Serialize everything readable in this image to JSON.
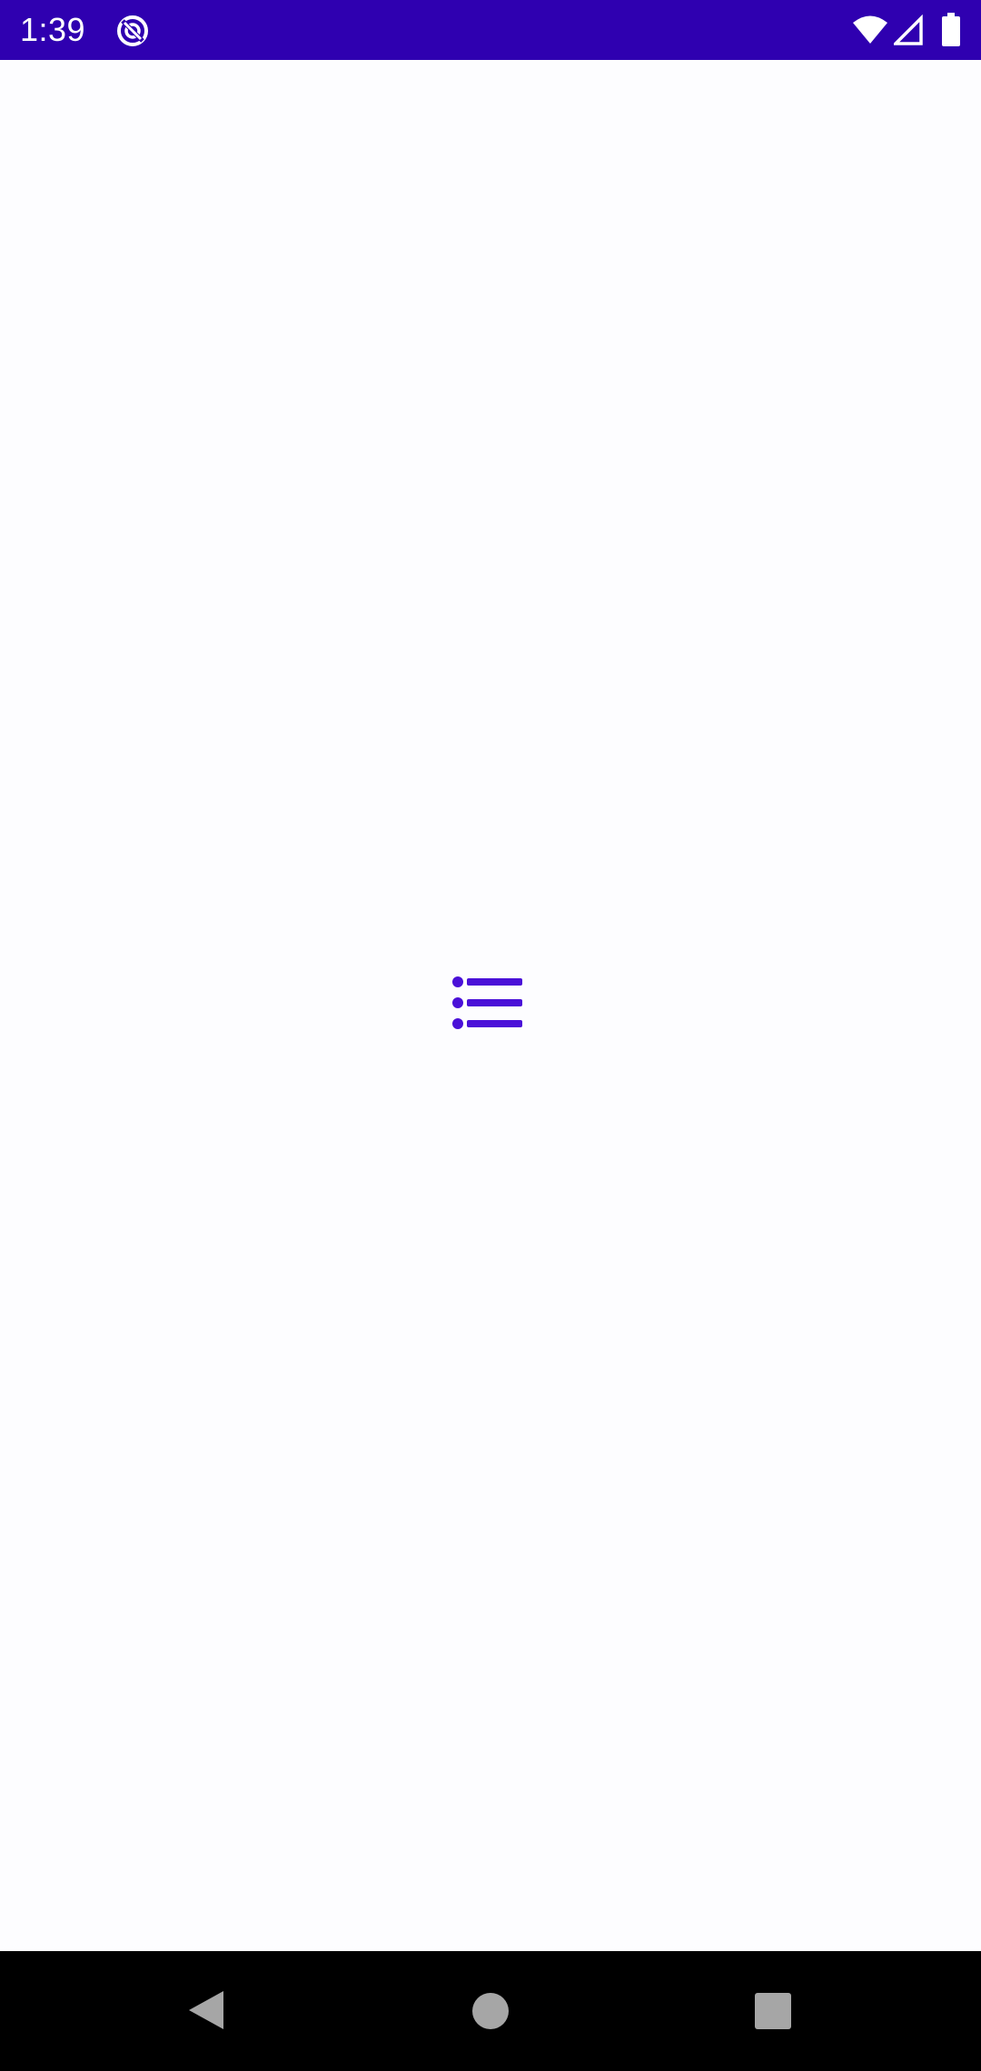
{
  "status_bar": {
    "time": "1:39",
    "background_color": "#2f00b0",
    "icons": {
      "app": "sync-circle-icon",
      "wifi": "wifi-icon",
      "signal": "cell-signal-icon",
      "battery": "battery-icon"
    }
  },
  "content": {
    "background_color": "#fdfdff",
    "center_icon": "list-icon",
    "accent_color": "#4a10d8"
  },
  "nav_bar": {
    "background_color": "#000000",
    "buttons": [
      "back-icon",
      "home-icon",
      "recents-icon"
    ]
  }
}
